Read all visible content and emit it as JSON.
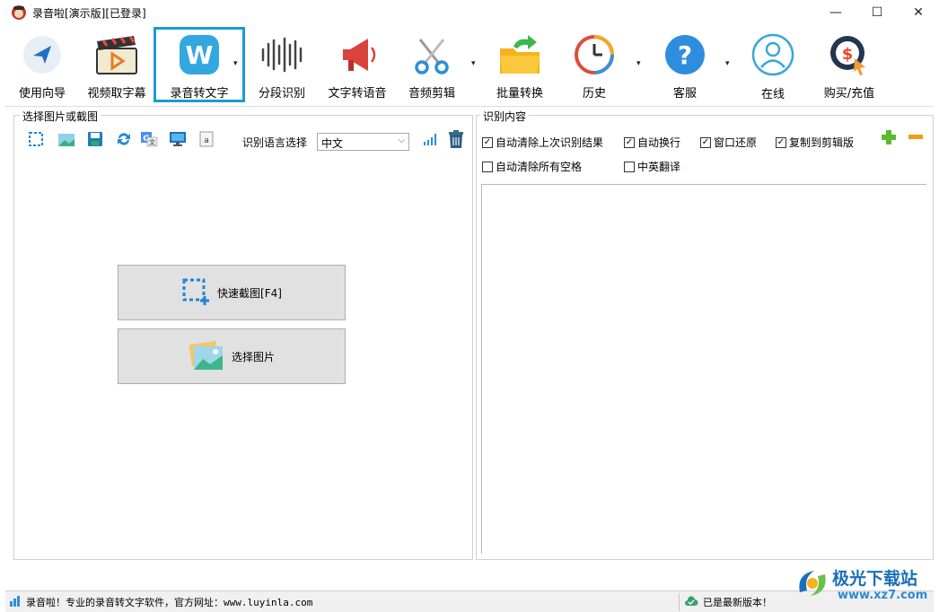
{
  "window": {
    "title": "录音啦[演示版][已登录]",
    "minimize": "—",
    "maximize": "☐",
    "close": "✕"
  },
  "toolbar": {
    "items": [
      {
        "label": "使用向导",
        "icon": "navigation-arrow-icon"
      },
      {
        "label": "视频取字幕",
        "icon": "video-clapperboard-icon"
      },
      {
        "label": "录音转文字",
        "icon": "w-letter-icon",
        "selected": true
      },
      {
        "label": "分段识别",
        "icon": "waveform-icon"
      },
      {
        "label": "文字转语音",
        "icon": "megaphone-icon"
      },
      {
        "label": "音频剪辑",
        "icon": "scissors-icon"
      },
      {
        "label": "批量转换",
        "icon": "folder-arrow-icon"
      },
      {
        "label": "历史",
        "icon": "clock-history-icon"
      },
      {
        "label": "客服",
        "icon": "question-icon"
      },
      {
        "label": "在线",
        "icon": "user-circle-icon"
      },
      {
        "label": "购买/充值",
        "icon": "dollar-cursor-icon"
      }
    ],
    "dropdown_glyph": "▾"
  },
  "left_panel": {
    "title": "选择图片或截图",
    "language_label": "识别语言选择",
    "language_value": "中文",
    "quick_capture_label": "快速截图[F4]",
    "select_image_label": "选择图片"
  },
  "right_panel": {
    "title": "识别内容",
    "options": [
      {
        "label": "自动清除上次识别结果",
        "checked": true
      },
      {
        "label": "自动换行",
        "checked": true
      },
      {
        "label": "窗口还原",
        "checked": true
      },
      {
        "label": "复制到剪辑版",
        "checked": true
      },
      {
        "label": "自动清除所有空格",
        "checked": false
      },
      {
        "label": "中英翻译",
        "checked": false
      }
    ]
  },
  "statusbar": {
    "left_text": "录音啦！专业的录音转文字软件，官方网址：www.luyinla.com",
    "right_text": "已是最新版本！"
  },
  "watermark": {
    "name": "极光下载站",
    "url": "www.xz7.com"
  },
  "colors": {
    "accent": "#1a9ad6",
    "button_bg": "#e1e1e1",
    "plus_green": "#5cb82e",
    "minus_orange": "#f39c12"
  }
}
